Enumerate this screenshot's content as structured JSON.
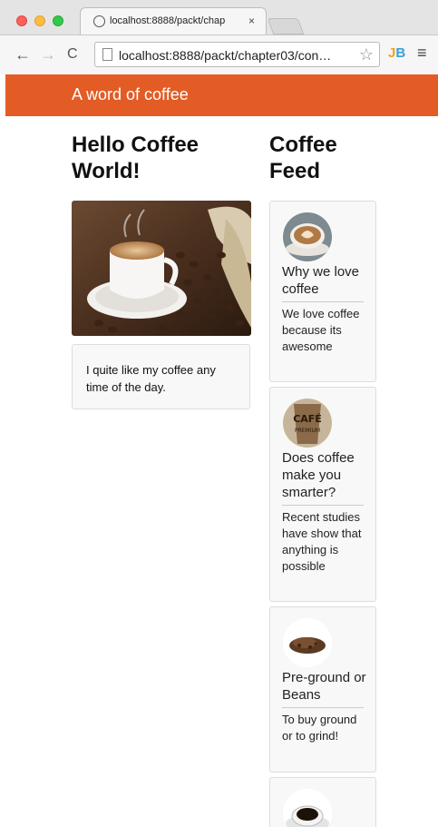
{
  "browser": {
    "tab_title": "localhost:8888/packt/chap",
    "tab_close": "×",
    "url": "localhost:8888/packt/chapter03/con…",
    "ext_j": "J",
    "ext_b": "B"
  },
  "header": {
    "title": "A word of coffee"
  },
  "main": {
    "heading": "Hello Coffee World!",
    "card_text": "I quite like my coffee any time of the day."
  },
  "feed": {
    "heading": "Coffee Feed",
    "items": [
      {
        "title": "Why we love coffee",
        "body": "We love coffee because its awesome"
      },
      {
        "title": "Does coffee make you smarter?",
        "body": "Recent studies have show that anything is possible"
      },
      {
        "title": "Pre-ground or Beans",
        "body": "To buy ground or to grind!"
      },
      {
        "title": "",
        "body": ""
      }
    ]
  },
  "colors": {
    "header_bg": "#e35c25"
  }
}
